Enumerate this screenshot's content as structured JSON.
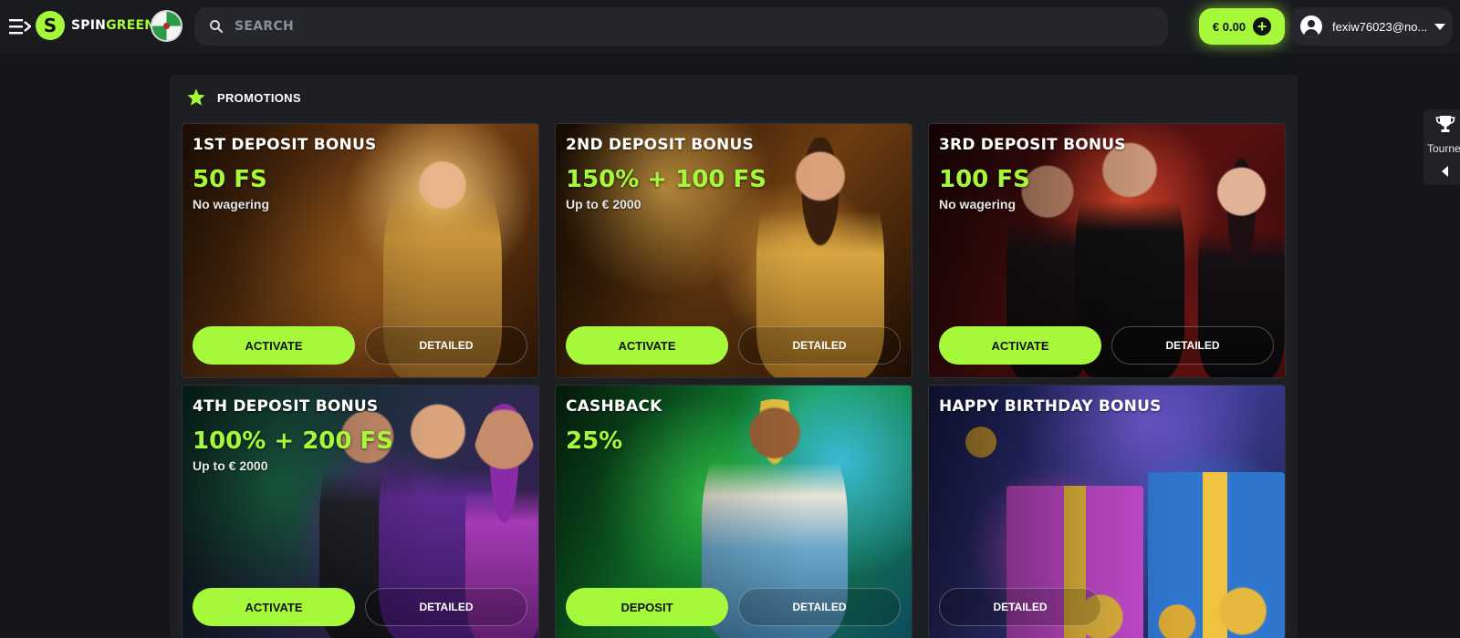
{
  "header": {
    "logo_mark": "S",
    "logo_text_part1": "SPIN",
    "logo_text_part2": "GREEN",
    "search_placeholder": "SEARCH",
    "balance": "€ 0.00",
    "balance_plus": "+",
    "user_email": "fexiw76023@no..."
  },
  "colors": {
    "accent": "#a6f83a",
    "background": "#14161a",
    "panel": "#1d1f23"
  },
  "promotions": {
    "title": "PROMOTIONS",
    "cards": [
      {
        "title": "1ST DEPOSIT BONUS",
        "amount": "50 FS",
        "subtitle": "No wagering",
        "primary": "ACTIVATE",
        "secondary": "DETAILED"
      },
      {
        "title": "2ND DEPOSIT BONUS",
        "amount": "150% + 100 FS",
        "subtitle": "Up to € 2000",
        "primary": "ACTIVATE",
        "secondary": "DETAILED"
      },
      {
        "title": "3RD DEPOSIT BONUS",
        "amount": "100 FS",
        "subtitle": "No wagering",
        "primary": "ACTIVATE",
        "secondary": "DETAILED"
      },
      {
        "title": "4TH DEPOSIT BONUS",
        "amount": "100% + 200 FS",
        "subtitle": "Up to € 2000",
        "primary": "ACTIVATE",
        "secondary": "DETAILED"
      },
      {
        "title": "CASHBACK",
        "amount": "25%",
        "subtitle": "",
        "primary": "DEPOSIT",
        "secondary": "DETAILED"
      },
      {
        "title": "HAPPY BIRTHDAY BONUS",
        "amount": "",
        "subtitle": "",
        "primary": "",
        "secondary": "DETAILED"
      }
    ]
  },
  "side_tab": {
    "label": "Tourne",
    "icon": "trophy-icon"
  }
}
